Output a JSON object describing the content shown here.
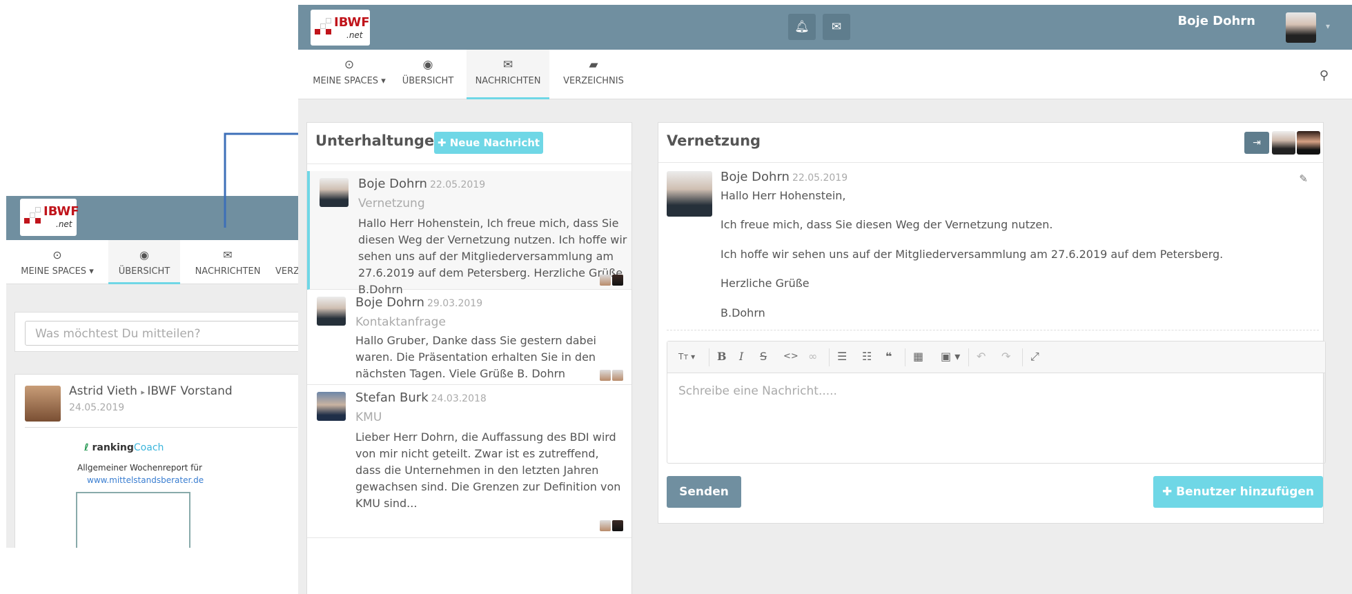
{
  "background_screen": {
    "nav": [
      {
        "icon": "target-icon",
        "label": "MEINE SPACES"
      },
      {
        "icon": "dashboard-icon",
        "label": "ÜBERSICHT"
      },
      {
        "icon": "envelope-icon",
        "label": "NACHRICHTEN"
      },
      {
        "icon": "book-icon",
        "label": "VERZ"
      }
    ],
    "post_placeholder": "Was möchtest Du mitteilen?",
    "post": {
      "author": "Astrid Vieth",
      "target": "IBWF Vorstand",
      "date": "24.05.2019",
      "brand_a": "ranking",
      "brand_b": "Coach",
      "report_line": "Allgemeiner Wochenreport für",
      "report_url": "www.mittelstandsberater.de"
    }
  },
  "header": {
    "logo_text": "IBWF",
    "logo_sub": ".net",
    "user_name": "Boje Dohrn"
  },
  "nav": [
    {
      "icon": "target-icon",
      "label": "MEINE SPACES"
    },
    {
      "icon": "dashboard-icon",
      "label": "ÜBERSICHT"
    },
    {
      "icon": "envelope-icon",
      "label": "NACHRICHTEN"
    },
    {
      "icon": "book-icon",
      "label": "VERZEICHNIS"
    }
  ],
  "conversations": {
    "title": "Unterhaltungen",
    "new_button": "Neue Nachricht",
    "items": [
      {
        "author": "Boje Dohrn",
        "date": "22.05.2019",
        "subject": "Vernetzung",
        "preview": "Hallo Herr Hohenstein, Ich freue mich, dass Sie diesen Weg der Vernetzung nutzen. Ich hoffe wir sehen uns auf der Mitgliederversammlung am 27.6.2019 auf dem Petersberg. Herzliche Grüße B.Dohrn"
      },
      {
        "author": "Boje Dohrn",
        "date": "29.03.2019",
        "subject": "Kontaktanfrage",
        "preview": "Hallo Gruber, Danke dass Sie gestern dabei waren. Die Präsentation erhalten Sie in den nächsten Tagen. Viele Grüße B. Dohrn"
      },
      {
        "author": "Stefan Burk",
        "date": "24.03.2018",
        "subject": "KMU",
        "preview": "Lieber Herr Dohrn, die Auffassung des BDI wird von mir nicht geteilt. Zwar ist es zutreffend, dass die Unternehmen in den letzten Jahren gewachsen sind. Die Grenzen zur Definition von KMU sind..."
      }
    ]
  },
  "detail": {
    "title": "Vernetzung",
    "message": {
      "author": "Boje Dohrn",
      "date": "22.05.2019",
      "lines": [
        "Hallo Herr Hohenstein,",
        "Ich freue mich, dass Sie diesen Weg der Vernetzung nutzen.",
        "Ich hoffe wir sehen uns auf der Mitgliederversammlung am 27.6.2019 auf dem Petersberg.",
        "Herzliche Grüße",
        "B.Dohrn"
      ]
    },
    "editor_placeholder": "Schreibe eine Nachricht.....",
    "send_button": "Senden",
    "add_user_button": "Benutzer hinzufügen"
  },
  "colors": {
    "header": "#708fa0",
    "accent": "#6fd7e6",
    "brand_red": "#c0141b"
  }
}
